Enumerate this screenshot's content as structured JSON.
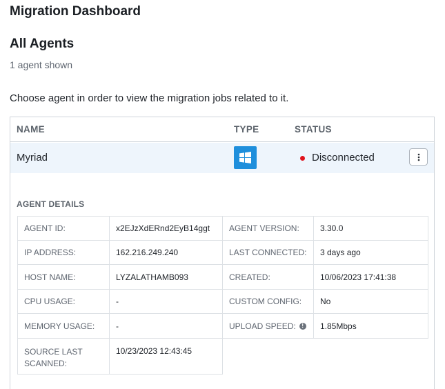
{
  "header": {
    "title": "Migration Dashboard"
  },
  "section": {
    "title": "All Agents",
    "count_text": "1 agent shown",
    "instruction": "Choose agent in order to view the migration jobs related to it."
  },
  "table": {
    "columns": {
      "name": "NAME",
      "type": "TYPE",
      "status": "STATUS"
    },
    "rows": [
      {
        "name": "Myriad",
        "type_icon": "windows-icon",
        "status": "Disconnected",
        "status_color": "#e0131c"
      }
    ]
  },
  "details": {
    "title": "AGENT DETAILS",
    "agent_id_label": "AGENT ID:",
    "agent_id": "x2EJzXdERnd2EyB14ggt",
    "agent_version_label": "AGENT VERSION:",
    "agent_version": "3.30.0",
    "ip_label": "IP ADDRESS:",
    "ip": "162.216.249.240",
    "last_connected_label": "LAST CONNECTED:",
    "last_connected": "3 days ago",
    "host_label": "HOST NAME:",
    "host": "LYZALATHAMB093",
    "created_label": "CREATED:",
    "created": "10/06/2023 17:41:38",
    "cpu_label": "CPU USAGE:",
    "cpu": "-",
    "custom_config_label": "CUSTOM CONFIG:",
    "custom_config": "No",
    "memory_label": "MEMORY USAGE:",
    "memory": "-",
    "upload_speed_label": "UPLOAD SPEED:",
    "upload_speed": "1.85Mbps",
    "source_scanned_label": "SOURCE LAST SCANNED:",
    "source_scanned": "10/23/2023 12:43:45"
  },
  "colors": {
    "accent": "#1f8fdc",
    "selected_row": "#eef5fc",
    "status_error": "#e0131c"
  }
}
